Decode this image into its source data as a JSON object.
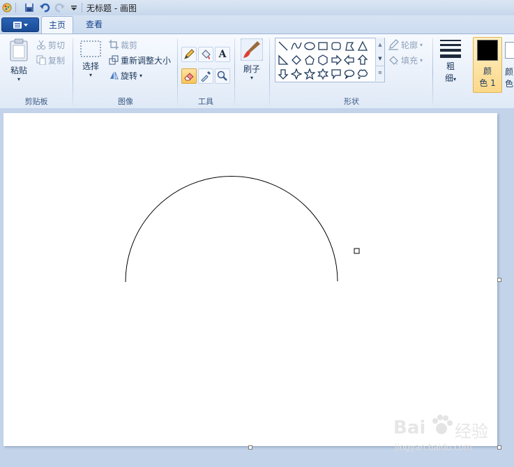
{
  "window": {
    "title": "无标题 - 画图"
  },
  "tabs": [
    {
      "label": "主页",
      "active": true
    },
    {
      "label": "查看",
      "active": false
    }
  ],
  "clipboard": {
    "paste_label": "粘贴",
    "cut_label": "剪切",
    "copy_label": "复制",
    "group_label": "剪贴板"
  },
  "image": {
    "select_label": "选择",
    "crop_label": "裁剪",
    "resize_label": "重新调整大小",
    "rotate_label": "旋转",
    "group_label": "图像"
  },
  "tools": {
    "group_label": "工具",
    "text_tool_glyph": "A"
  },
  "brush": {
    "label": "刷子"
  },
  "shapes": {
    "group_label": "形状",
    "outline_label": "轮廓",
    "fill_label": "填充"
  },
  "size": {
    "label_line1": "粗",
    "label_line2": "细"
  },
  "color1": {
    "label_line1": "颜",
    "label_line2": "色 1",
    "value": "#000000"
  },
  "color2": {
    "label_line1": "颜",
    "label_line2": "色"
  },
  "watermark": {
    "brand": "Bai",
    "brand_suffix": "经验",
    "url": "jingyan.baidu.com"
  }
}
